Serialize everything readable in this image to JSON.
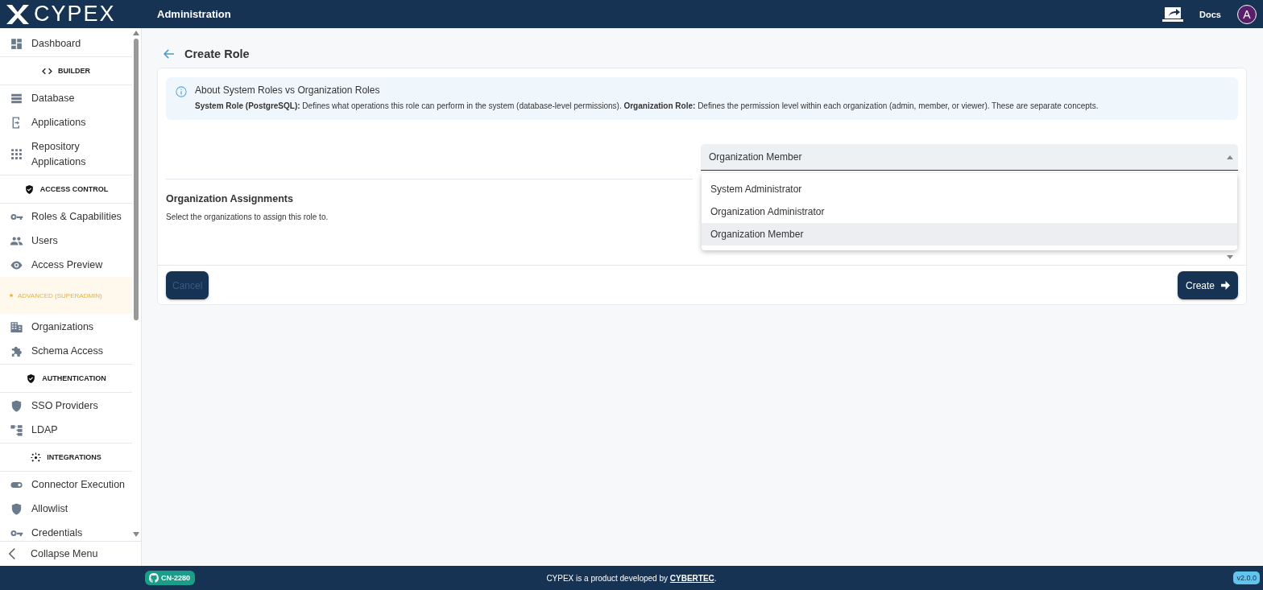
{
  "header": {
    "logo": "CYPEX",
    "title": "Administration",
    "docs": "Docs",
    "avatar": "A"
  },
  "sidebar": {
    "items": [
      {
        "kind": "item",
        "label": "Dashboard"
      },
      {
        "kind": "section",
        "label": "BUILDER"
      },
      {
        "kind": "item",
        "label": "Database"
      },
      {
        "kind": "item",
        "label": "Applications"
      },
      {
        "kind": "item",
        "label": "Repository Applications"
      },
      {
        "kind": "section",
        "label": "ACCESS CONTROL"
      },
      {
        "kind": "item",
        "label": "Roles & Capabilities"
      },
      {
        "kind": "item",
        "label": "Users"
      },
      {
        "kind": "item",
        "label": "Access Preview"
      },
      {
        "kind": "advanced",
        "label": "ADVANCED (SUPERADMIN)"
      },
      {
        "kind": "item",
        "label": "Organizations"
      },
      {
        "kind": "item",
        "label": "Schema Access"
      },
      {
        "kind": "section",
        "label": "AUTHENTICATION"
      },
      {
        "kind": "item",
        "label": "SSO Providers"
      },
      {
        "kind": "item",
        "label": "LDAP"
      },
      {
        "kind": "section",
        "label": "INTEGRATIONS"
      },
      {
        "kind": "item",
        "label": "Connector Execution"
      },
      {
        "kind": "item",
        "label": "Allowlist"
      },
      {
        "kind": "item",
        "label": "Credentials"
      }
    ],
    "collapse": "Collapse Menu"
  },
  "page": {
    "title": "Create Role",
    "info": {
      "title": "About System Roles vs Organization Roles",
      "text": "**System Role (PostgreSQL):** Defines what operations this role can perform in the system (database-level permissions). **Organization Role:** Defines the permission level within each organization (admin, member, or viewer). These are separate concepts."
    },
    "role_select": {
      "value": "Organization Member",
      "expanded": true,
      "options": [
        {
          "label": "System Administrator",
          "selected": false
        },
        {
          "label": "Organization Administrator",
          "selected": false
        },
        {
          "label": "Organization Member",
          "selected": true
        }
      ]
    },
    "assignments": {
      "title": "Organization Assignments",
      "subtitle": "Select the organizations to assign this role to."
    },
    "buttons": {
      "cancel": "Cancel",
      "create": "Create"
    }
  },
  "footer": {
    "badge": "CN-2280",
    "text": "CYPEX is a product developed by ",
    "link": "CYBERTEC",
    "after": ".",
    "version": "v2.0.0"
  }
}
